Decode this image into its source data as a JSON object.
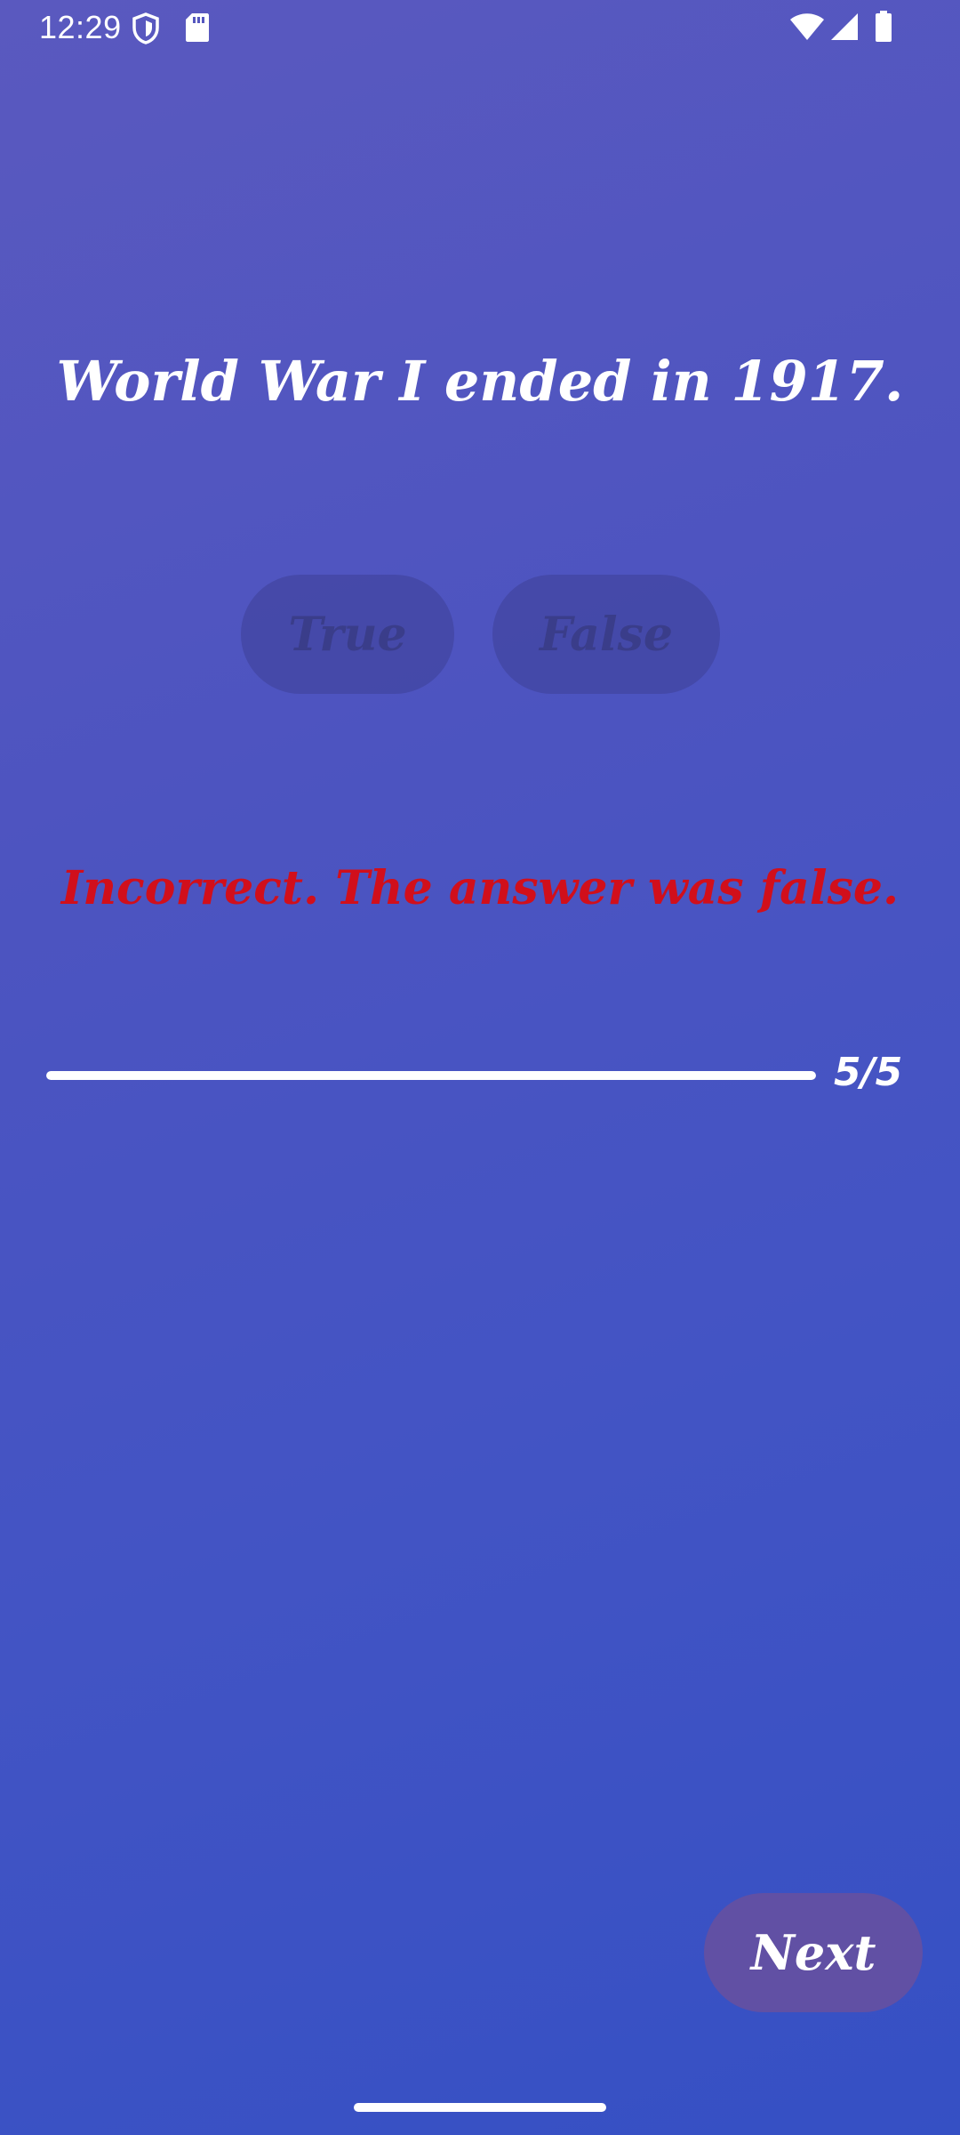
{
  "status_bar": {
    "time": "12:29",
    "icons": [
      "shield-icon",
      "sd-card-icon",
      "wifi-icon",
      "cell-signal-icon",
      "battery-icon"
    ]
  },
  "quiz": {
    "question": "World War I ended in 1917.",
    "answers": [
      {
        "label": "True"
      },
      {
        "label": "False"
      }
    ],
    "feedback": "Incorrect. The answer was false.",
    "feedback_color": "#d10f1b",
    "progress": {
      "current": 5,
      "total": 5,
      "label": "5/5",
      "fraction": 1.0
    },
    "next_label": "Next"
  },
  "colors": {
    "background_start": "#5a59bf",
    "background_end": "#3550c4",
    "disabled_button": "#3e4096",
    "next_button": "#6150a4"
  }
}
